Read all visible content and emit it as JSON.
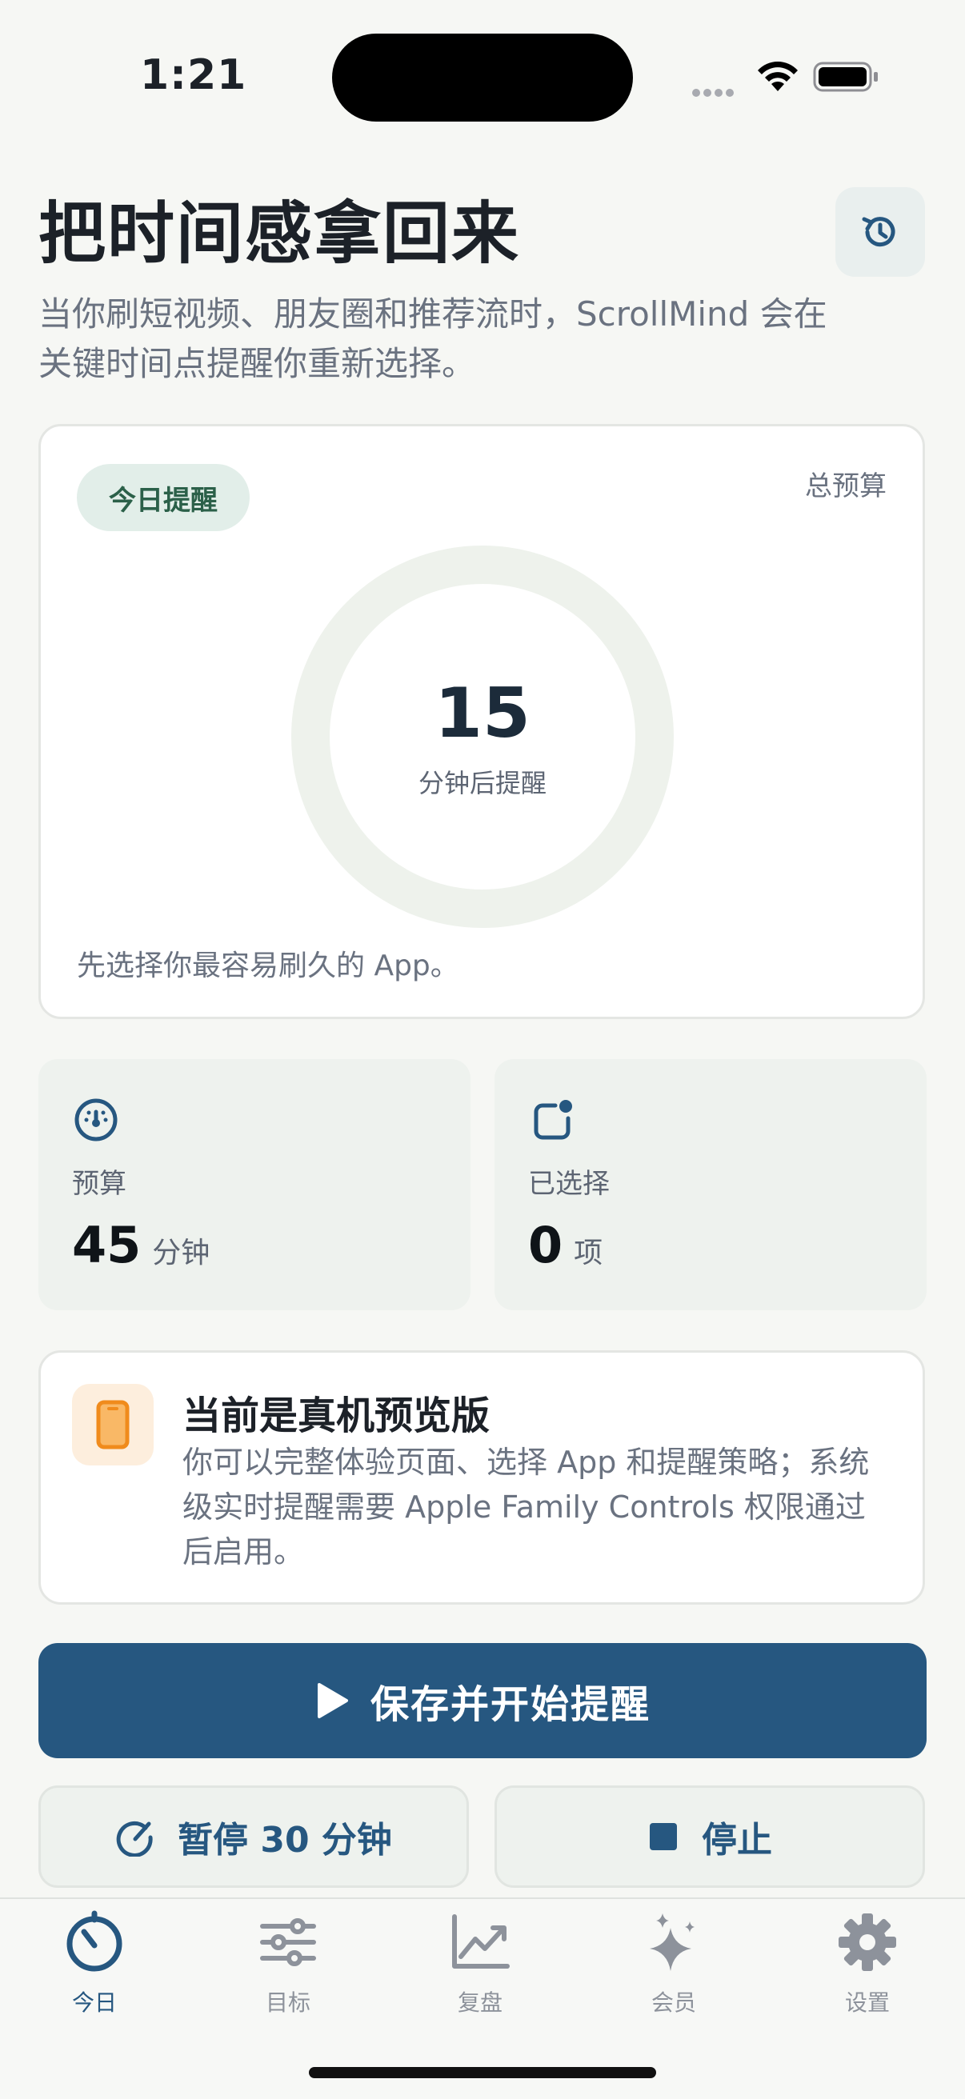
{
  "status_bar": {
    "time": "1:21"
  },
  "header": {
    "title": "把时间感拿回来",
    "subtitle": "当你刷短视频、朋友圈和推荐流时，ScrollMind 会在关键时间点提醒你重新选择。",
    "history_icon": "history-icon"
  },
  "today_card": {
    "badge": "今日提醒",
    "total_budget_label": "总预算",
    "ring_value": "15",
    "ring_label": "分钟后提醒",
    "hint": "先选择你最容易刷久的 App。"
  },
  "stats": {
    "budget": {
      "label": "预算",
      "value": "45",
      "unit": "分钟",
      "icon": "gauge-icon"
    },
    "selected": {
      "label": "已选择",
      "value": "0",
      "unit": "项",
      "icon": "app-badge-icon"
    }
  },
  "preview_notice": {
    "title": "当前是真机预览版",
    "body": "你可以完整体验页面、选择 App 和提醒策略；系统级实时提醒需要 Apple Family Controls 权限通过后启用。",
    "icon": "phone-icon"
  },
  "actions": {
    "primary": "保存并开始提醒",
    "pause": "暂停 30 分钟",
    "stop": "停止"
  },
  "tabs": [
    {
      "label": "今日",
      "icon": "timer-icon",
      "active": true
    },
    {
      "label": "目标",
      "icon": "sliders-icon",
      "active": false
    },
    {
      "label": "复盘",
      "icon": "chart-icon",
      "active": false
    },
    {
      "label": "会员",
      "icon": "sparkles-icon",
      "active": false
    },
    {
      "label": "设置",
      "icon": "gear-icon",
      "active": false
    }
  ],
  "colors": {
    "accent": "#265780",
    "badge_green": "#2b6049",
    "ring_track": "#eef2ec",
    "preview_icon": "#f08b1c"
  }
}
